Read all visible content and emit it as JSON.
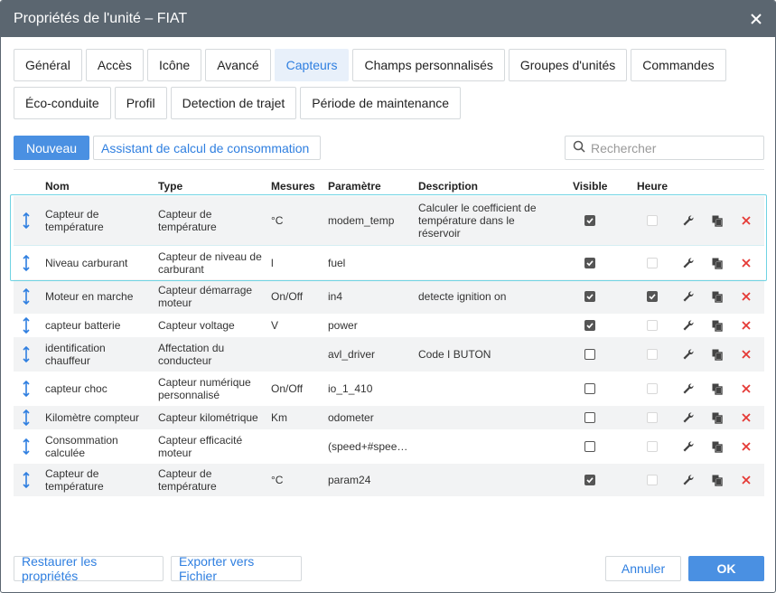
{
  "window": {
    "title": "Propriétés de l'unité – FIAT"
  },
  "tabs_row1": [
    "Général",
    "Accès",
    "Icône",
    "Avancé",
    "Capteurs",
    "Champs personnalisés",
    "Groupes d'unités",
    "Commandes"
  ],
  "tabs_row2": [
    "Éco-conduite",
    "Profil",
    "Detection de trajet",
    "Période de maintenance"
  ],
  "active_tab": "Capteurs",
  "toolbar": {
    "new_label": "Nouveau",
    "wizard_label": "Assistant de calcul de consommation",
    "search_placeholder": "Rechercher"
  },
  "columns": {
    "name": "Nom",
    "type": "Type",
    "measures": "Mesures",
    "param": "Paramètre",
    "description": "Description",
    "visible": "Visible",
    "hour": "Heure"
  },
  "sensors": [
    {
      "name": "Capteur de température",
      "type": "Capteur de température",
      "measures": "°C",
      "param": "modem_temp",
      "description": "Calculer le coefficient de température dans le réservoir",
      "visible": true,
      "hour": false,
      "hour_enabled": false,
      "selected": true
    },
    {
      "name": "Niveau carburant",
      "type": "Capteur de niveau de carburant",
      "measures": "l",
      "param": "fuel",
      "description": "",
      "visible": true,
      "hour": false,
      "hour_enabled": false,
      "selected": true
    },
    {
      "name": "Moteur en marche",
      "type": "Capteur démarrage moteur",
      "measures": "On/Off",
      "param": "in4",
      "description": "detecte ignition on",
      "visible": true,
      "hour": true,
      "hour_enabled": true,
      "selected": false
    },
    {
      "name": "capteur batterie",
      "type": "Capteur voltage",
      "measures": "V",
      "param": "power",
      "description": "",
      "visible": true,
      "hour": false,
      "hour_enabled": false,
      "selected": false
    },
    {
      "name": "identification chauffeur",
      "type": "Affectation du conducteur",
      "measures": "",
      "param": "avl_driver",
      "description": "Code I BUTON",
      "visible": false,
      "hour": false,
      "hour_enabled": false,
      "selected": false
    },
    {
      "name": "capteur choc",
      "type": "Capteur numérique personnalisé",
      "measures": "On/Off",
      "param": "io_1_410",
      "description": "",
      "visible": false,
      "hour": false,
      "hour_enabled": false,
      "selected": false
    },
    {
      "name": "Kilomètre compteur",
      "type": "Capteur kilométrique",
      "measures": "Km",
      "param": "odometer",
      "description": "",
      "visible": false,
      "hour": false,
      "hour_enabled": false,
      "selected": false
    },
    {
      "name": "Consommation calculée",
      "type": "Capteur efficacité moteur",
      "measures": "",
      "param": "(speed+#spee…",
      "description": "",
      "visible": false,
      "hour": false,
      "hour_enabled": false,
      "selected": false
    },
    {
      "name": "Capteur de température",
      "type": "Capteur de température",
      "measures": "°C",
      "param": "param24",
      "description": "",
      "visible": true,
      "hour": false,
      "hour_enabled": false,
      "selected": false
    }
  ],
  "footer": {
    "restore_label": "Restaurer les propriétés",
    "export_label": "Exporter vers Fichier",
    "cancel_label": "Annuler",
    "ok_label": "OK"
  },
  "colors": {
    "titlebar": "#5b6670",
    "accent": "#4a90e2",
    "delete": "#e53935",
    "selection": "#6fd3e3"
  }
}
